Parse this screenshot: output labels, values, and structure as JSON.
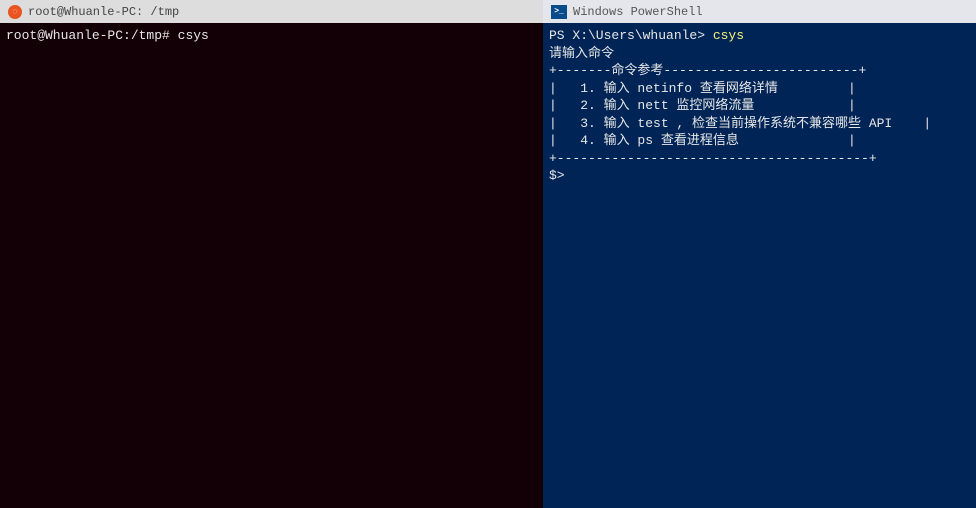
{
  "left": {
    "title": "root@Whuanle-PC: /tmp",
    "prompt": "root@Whuanle-PC:/tmp# ",
    "command": "csys"
  },
  "right": {
    "title": "Windows PowerShell",
    "ps_icon_text": ">_",
    "prompt": "PS X:\\Users\\whuanle> ",
    "command": "csys",
    "header_line1": "请输入命令",
    "box_top": "+-------命令参考-------------------------+",
    "items": [
      "|   1. 输入 netinfo 查看网络详情         |",
      "|   2. 输入 nett 监控网络流量            |",
      "|   3. 输入 test , 检查当前操作系统不兼容哪些 API    |",
      "|   4. 输入 ps 查看进程信息              |"
    ],
    "box_bottom": "+----------------------------------------+",
    "sub_prompt": "$>"
  }
}
